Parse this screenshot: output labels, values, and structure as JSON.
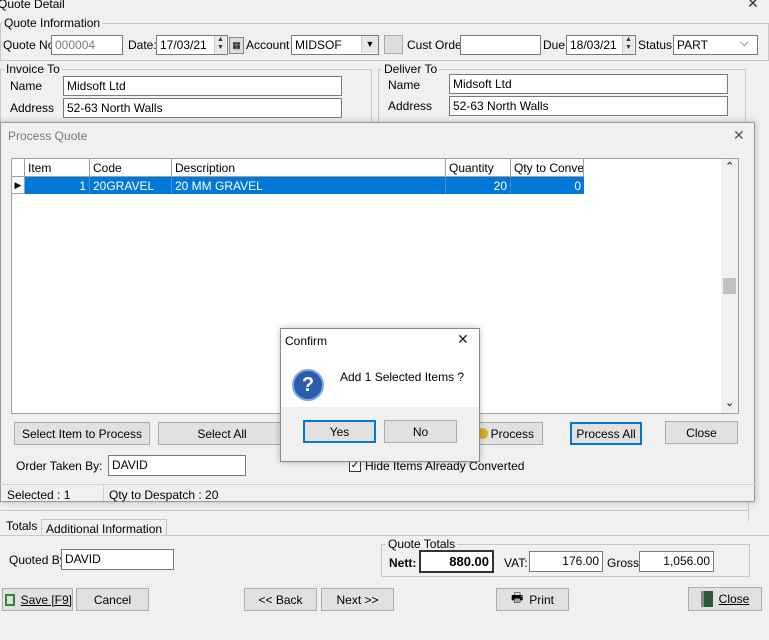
{
  "window": {
    "title": "Quote Detail"
  },
  "quote_info": {
    "group_label": "Quote Information",
    "quote_no_label": "Quote No",
    "quote_no_value": "000004",
    "date_label": "Date:",
    "date_value": "17/03/21",
    "account_label": "Account",
    "account_value": "MIDSOF",
    "cust_order_label": "Cust Order",
    "cust_order_value": "",
    "due_label": "Due",
    "due_value": "18/03/21",
    "status_label": "Status:",
    "status_value": "PART"
  },
  "invoice_to": {
    "group_label": "Invoice To",
    "name_label": "Name",
    "name_value": "Midsoft Ltd",
    "address_label": "Address",
    "address_value": "52-63 North Walls"
  },
  "deliver_to": {
    "group_label": "Deliver To",
    "name_label": "Name",
    "name_value": "Midsoft Ltd",
    "address_label": "Address",
    "address_value": "52-63 North Walls"
  },
  "process_quote": {
    "title": "Process Quote",
    "columns": [
      "Item",
      "Code",
      "Description",
      "Quantity",
      "Qty to Convert"
    ],
    "rows": [
      {
        "item": "1",
        "code": "20GRAVEL",
        "description": "20 MM GRAVEL",
        "quantity": "20",
        "qty_to_convert": "0"
      }
    ],
    "buttons": {
      "select_item": "Select Item to Process",
      "select_all": "Select All",
      "process": "Process",
      "process_all": "Process All",
      "close": "Close"
    },
    "order_taken_label": "Order Taken By:",
    "order_taken_value": "DAVID",
    "hide_converted_label": "Hide Items Already Converted",
    "status_selected": "Selected : 1",
    "status_qty": "Qty to Despatch : 20"
  },
  "confirm": {
    "title": "Confirm",
    "message": "Add 1 Selected Items ?",
    "yes": "Yes",
    "no": "No"
  },
  "bottom": {
    "tab_totals": "Totals",
    "tab_additional": "Additional Information",
    "quoted_by_label": "Quoted By:",
    "quoted_by_value": "DAVID",
    "totals_group_label": "Quote Totals",
    "nett_label": "Nett:",
    "nett_value": "880.00",
    "vat_label": "VAT:",
    "vat_value": "176.00",
    "gross_label": "Gross:",
    "gross_value": "1,056.00"
  },
  "footer": {
    "save": "Save [F9]",
    "cancel": "Cancel",
    "back": "<< Back",
    "next": "Next >>",
    "print": "Print",
    "close": "Close"
  },
  "colors": {
    "selection": "#0078d7",
    "focus": "#0078d7"
  }
}
